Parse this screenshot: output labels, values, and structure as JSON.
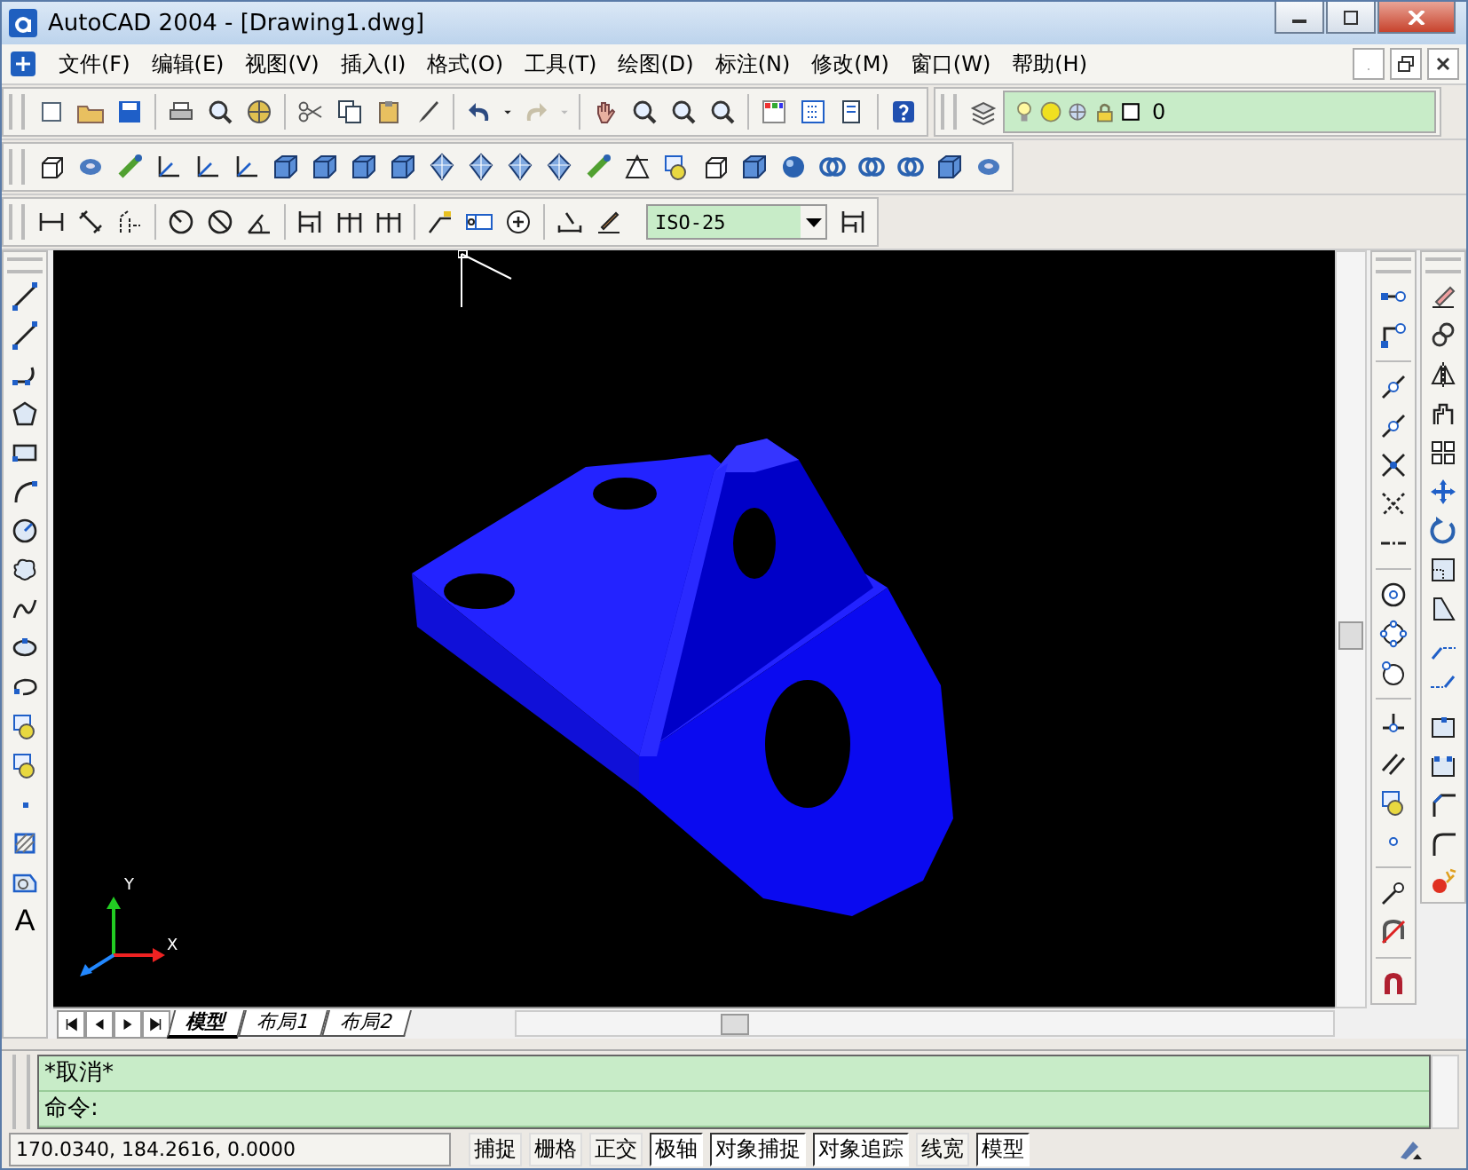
{
  "window": {
    "title": "AutoCAD 2004 - [Drawing1.dwg]"
  },
  "menu": [
    {
      "label": "文件(F)"
    },
    {
      "label": "编辑(E)"
    },
    {
      "label": "视图(V)"
    },
    {
      "label": "插入(I)"
    },
    {
      "label": "格式(O)"
    },
    {
      "label": "工具(T)"
    },
    {
      "label": "绘图(D)"
    },
    {
      "label": "标注(N)"
    },
    {
      "label": "修改(M)"
    },
    {
      "label": "窗口(W)"
    },
    {
      "label": "帮助(H)"
    }
  ],
  "layer_toolbar": {
    "layer_name": "0"
  },
  "dimension_toolbar": {
    "dim_style": "ISO-25"
  },
  "draw_toolbar": {
    "text_tool_glyph": "A"
  },
  "ucs_icon": {
    "x_label": "X",
    "y_label": "Y"
  },
  "layout_tabs": [
    {
      "label": "模型",
      "selected": true
    },
    {
      "label": "布局1",
      "selected": false
    },
    {
      "label": "布局2",
      "selected": false
    }
  ],
  "command_lines": [
    "*取消*",
    "命令:"
  ],
  "status_bar": {
    "coordinates": "170.0340, 184.2616, 0.0000",
    "toggles": [
      {
        "label": "捕捉",
        "on": false
      },
      {
        "label": "栅格",
        "on": false
      },
      {
        "label": "正交",
        "on": false
      },
      {
        "label": "极轴",
        "on": true
      },
      {
        "label": "对象捕捉",
        "on": true
      },
      {
        "label": "对象追踪",
        "on": true
      },
      {
        "label": "线宽",
        "on": false
      },
      {
        "label": "模型",
        "on": true
      }
    ]
  }
}
